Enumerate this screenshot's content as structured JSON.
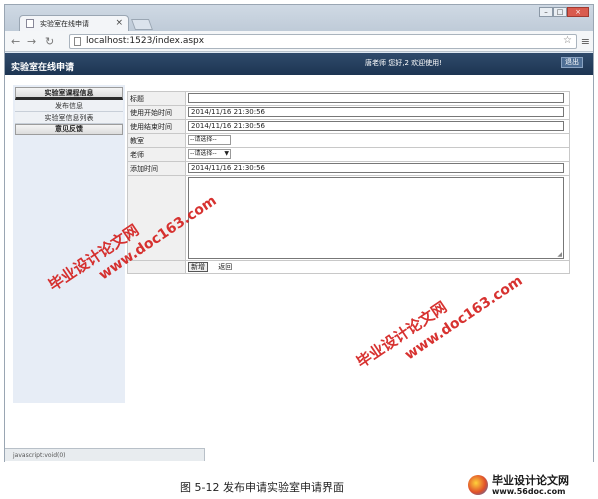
{
  "browser": {
    "tab_title": "实验室在线申请",
    "url": "localhost:1523/index.aspx"
  },
  "header": {
    "title": "实验室在线申请",
    "greeting": "唐老师 您好,2 欢迎使用!",
    "logout_label": "退出"
  },
  "sidebar": {
    "section1": "实验室课程信息",
    "items": [
      "发布信息",
      "实验室信息列表"
    ],
    "section2": "意见反馈"
  },
  "form": {
    "title_label": "标题",
    "title_value": "",
    "start_label": "使用开始时间",
    "start_value": "2014/11/16 21:30:56",
    "end_label": "使用结束时间",
    "end_value": "2014/11/16 21:30:56",
    "room_label": "教室",
    "room_select": "--请选择--",
    "teacher_label": "老师",
    "teacher_select": "--请选择--",
    "added_label": "添加时间",
    "added_value": "2014/11/16 21:30:56",
    "content_value": "",
    "add_button": "新增",
    "back_link": "返回"
  },
  "status_bar": "javascript:void(0)",
  "caption": "图 5-12 发布申请实验室申请界面",
  "watermarks": {
    "cn": "毕业设计论文网",
    "url": "www.doc163.com"
  },
  "footer_logo": {
    "cn": "毕业设计论文网",
    "url": "www.56doc.com"
  }
}
